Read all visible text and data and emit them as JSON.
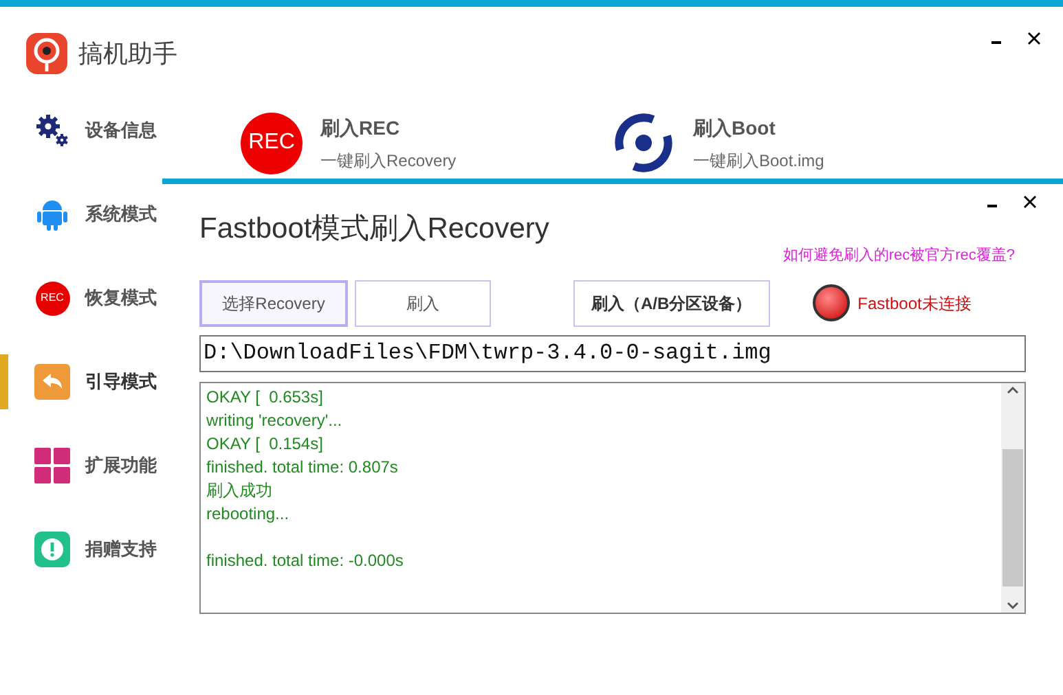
{
  "app": {
    "title": "搞机助手"
  },
  "sidebar": {
    "items": [
      {
        "label": "设备信息",
        "selected": false
      },
      {
        "label": "系统模式",
        "selected": false
      },
      {
        "label": "恢复模式",
        "icon_text": "REC",
        "selected": false
      },
      {
        "label": "引导模式",
        "selected": true
      },
      {
        "label": "扩展功能",
        "selected": false
      },
      {
        "label": "捐赠支持",
        "selected": false
      }
    ]
  },
  "cards": [
    {
      "kind": "rec",
      "icon_text": "REC",
      "title": "刷入REC",
      "subtitle": "一键刷入Recovery"
    },
    {
      "kind": "boot",
      "title": "刷入Boot",
      "subtitle": "一键刷入Boot.img"
    }
  ],
  "dialog": {
    "title": "Fastboot模式刷入Recovery",
    "help_link": "如何避免刷入的rec被官方rec覆盖?",
    "buttons": [
      {
        "label": "选择Recovery",
        "focused": true,
        "bold": false
      },
      {
        "label": "刷入",
        "focused": false,
        "bold": false
      },
      {
        "label": "刷入（A/B分区设备）",
        "focused": false,
        "bold": true
      }
    ],
    "status": {
      "connected": false,
      "label": "Fastboot未连接"
    },
    "path": "D:\\DownloadFiles\\FDM\\twrp-3.4.0-0-sagit.img",
    "log": [
      {
        "text": "OKAY [  0.653s]",
        "gap_before": false
      },
      {
        "text": "writing 'recovery'...",
        "gap_before": false
      },
      {
        "text": "OKAY [  0.154s]",
        "gap_before": false
      },
      {
        "text": "finished. total time: 0.807s",
        "gap_before": false
      },
      {
        "text": "刷入成功",
        "gap_before": false
      },
      {
        "text": "rebooting...",
        "gap_before": false
      },
      {
        "text": "finished. total time: -0.000s",
        "gap_before": true
      }
    ]
  }
}
